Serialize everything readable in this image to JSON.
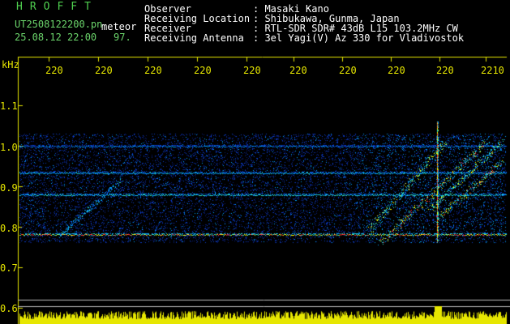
{
  "header": {
    "logo": "HROFFT",
    "filename": "UT2508122200.pn",
    "mode": "meteor",
    "datetime": "25.08.12 22:00",
    "count": "97.",
    "fields": [
      {
        "label": "Observer",
        "value": ": Masaki Kano"
      },
      {
        "label": "Receiving Location",
        "value": ": Shibukawa, Gunma, Japan"
      },
      {
        "label": "Receiver",
        "value": ": RTL-SDR SDR# 43dB L15 103.2MHz CW"
      },
      {
        "label": "Receiving Antenna",
        "value": ": 3el Yagi(V) Az 330 for Vladivostok"
      }
    ]
  },
  "axis": {
    "unit": "kHz",
    "x_ticks": [
      "220",
      "220",
      "220",
      "220",
      "220",
      "220",
      "220",
      "220",
      "220",
      "2210"
    ],
    "y_ticks": [
      "1.1",
      "1.0",
      "0.9",
      "0.8",
      "0.7",
      "0.6"
    ]
  },
  "colors": {
    "background": "#000000",
    "axis": "#e6e600",
    "header_green": "#6cd66c",
    "signal_low": "#0a1e78",
    "signal_mid": "#00a0ff",
    "signal_high": "#ffff00",
    "signal_peak": "#ff3030"
  }
}
